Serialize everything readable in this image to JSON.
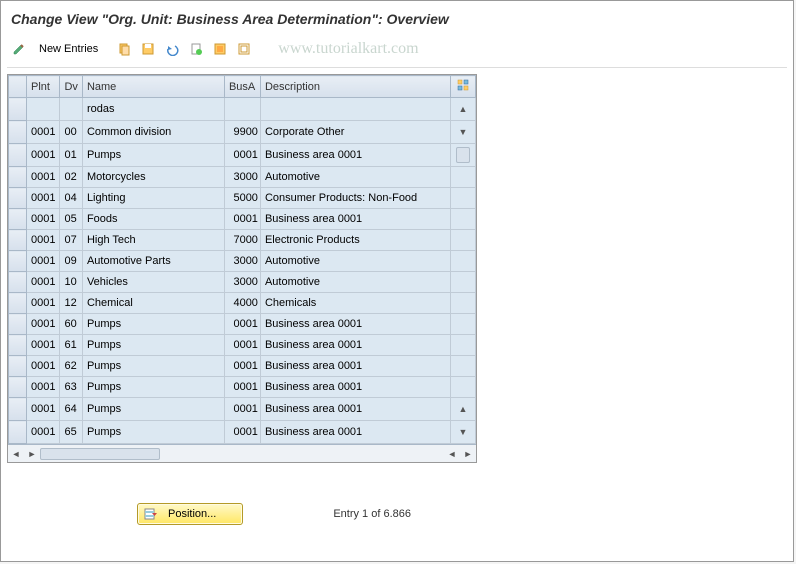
{
  "title": "Change View \"Org. Unit: Business Area Determination\": Overview",
  "watermark": "www.tutorialkart.com",
  "toolbar": {
    "new_entries_label": "New Entries"
  },
  "columns": {
    "plnt": "Plnt",
    "dv": "Dv",
    "name": "Name",
    "busa": "BusA",
    "desc": "Description"
  },
  "rows": [
    {
      "plnt": "",
      "dv": "",
      "name": "rodas",
      "busa": "",
      "desc": ""
    },
    {
      "plnt": "0001",
      "dv": "00",
      "name": "Common division",
      "busa": "9900",
      "desc": "Corporate Other"
    },
    {
      "plnt": "0001",
      "dv": "01",
      "name": "Pumps",
      "busa": "0001",
      "desc": " Business area 0001"
    },
    {
      "plnt": "0001",
      "dv": "02",
      "name": "Motorcycles",
      "busa": "3000",
      "desc": "Automotive"
    },
    {
      "plnt": "0001",
      "dv": "04",
      "name": "Lighting",
      "busa": "5000",
      "desc": "Consumer Products: Non-Food"
    },
    {
      "plnt": "0001",
      "dv": "05",
      "name": "Foods",
      "busa": "0001",
      "desc": " Business area 0001"
    },
    {
      "plnt": "0001",
      "dv": "07",
      "name": "High Tech",
      "busa": "7000",
      "desc": "Electronic Products"
    },
    {
      "plnt": "0001",
      "dv": "09",
      "name": "Automotive Parts",
      "busa": "3000",
      "desc": "Automotive"
    },
    {
      "plnt": "0001",
      "dv": "10",
      "name": "Vehicles",
      "busa": "3000",
      "desc": "Automotive"
    },
    {
      "plnt": "0001",
      "dv": "12",
      "name": "Chemical",
      "busa": "4000",
      "desc": "Chemicals"
    },
    {
      "plnt": "0001",
      "dv": "60",
      "name": "Pumps",
      "busa": "0001",
      "desc": " Business area 0001"
    },
    {
      "plnt": "0001",
      "dv": "61",
      "name": "Pumps",
      "busa": "0001",
      "desc": " Business area 0001"
    },
    {
      "plnt": "0001",
      "dv": "62",
      "name": "Pumps",
      "busa": "0001",
      "desc": " Business area 0001"
    },
    {
      "plnt": "0001",
      "dv": "63",
      "name": "Pumps",
      "busa": "0001",
      "desc": " Business area 0001"
    },
    {
      "plnt": "0001",
      "dv": "64",
      "name": "Pumps",
      "busa": "0001",
      "desc": " Business area 0001"
    },
    {
      "plnt": "0001",
      "dv": "65",
      "name": "Pumps",
      "busa": "0001",
      "desc": " Business area 0001"
    }
  ],
  "footer": {
    "position_label": "Position...",
    "entry_text": "Entry 1 of 6.866"
  },
  "icons": {
    "pencil": "✎",
    "copy": "📋",
    "save": "💾",
    "undo": "↶",
    "new": "🗎",
    "select": "▦",
    "deselect": "▢",
    "config": "🔧",
    "position": "📑"
  }
}
